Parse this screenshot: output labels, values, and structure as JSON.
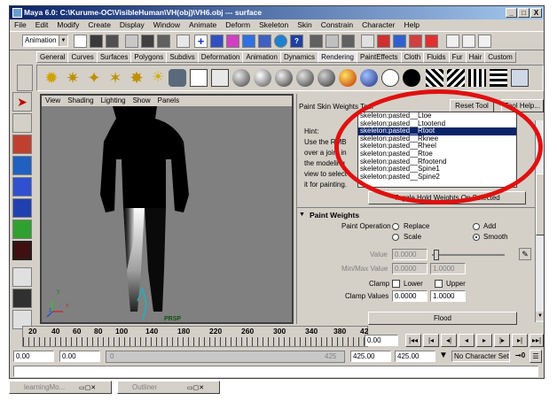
{
  "window": {
    "title": "Maya 6.0: C:\\Kurume-OC\\VisibleHuman\\VH(obj)\\VH6.obj   ---   surface",
    "minimize": "_",
    "maximize": "□",
    "close": "X"
  },
  "menu": [
    "File",
    "Edit",
    "Modify",
    "Create",
    "Display",
    "Window",
    "Animate",
    "Deform",
    "Skeleton",
    "Skin",
    "Constrain",
    "Character",
    "Help"
  ],
  "module_combo": "Animation",
  "shelf_tabs": [
    {
      "label": "General",
      "active": false
    },
    {
      "label": "Curves",
      "active": false
    },
    {
      "label": "Surfaces",
      "active": false
    },
    {
      "label": "Polygons",
      "active": false
    },
    {
      "label": "Subdivs",
      "active": false
    },
    {
      "label": "Deformation",
      "active": false
    },
    {
      "label": "Animation",
      "active": false
    },
    {
      "label": "Dynamics",
      "active": false
    },
    {
      "label": "Rendering",
      "active": true
    },
    {
      "label": "PaintEffects",
      "active": false
    },
    {
      "label": "Cloth",
      "active": false
    },
    {
      "label": "Fluids",
      "active": false
    },
    {
      "label": "Fur",
      "active": false
    },
    {
      "label": "Hair",
      "active": false
    },
    {
      "label": "Custom",
      "active": false
    }
  ],
  "viewport": {
    "menu": [
      "View",
      "Shading",
      "Lighting",
      "Show",
      "Panels"
    ],
    "camera_label": "PRSP",
    "axis_labels": {
      "y": "y",
      "x": "x",
      "z": "z"
    }
  },
  "tool_settings": {
    "title": "Paint Skin Weights Tool",
    "reset_button": "Reset Tool",
    "help_button": "Tool Help...",
    "hint_lines": [
      "Hint:",
      "Use the RMB",
      "over a joint in",
      "the modeling",
      "view to select",
      "it for painting."
    ],
    "joints": [
      "skeleton:pasted__Ltoe",
      "skeleton:pasted__Ltootend",
      "skeleton:pasted__Rtoot",
      "skeleton:pasted__Rknee",
      "skeleton:pasted__Rheel",
      "skeleton:pasted__Rtoe",
      "skeleton:pasted__Rfootend",
      "skeleton:pasted__Spine1",
      "skeleton:pasted__Spine2"
    ],
    "selected_joint_index": 2,
    "toggle_button": "Toggle Hold Weights On Selected",
    "section_title": "Paint Weights",
    "paint_operation_label": "Paint Operation",
    "operations": [
      {
        "label": "Replace",
        "selected": false
      },
      {
        "label": "Add",
        "selected": false
      },
      {
        "label": "Scale",
        "selected": false
      },
      {
        "label": "Smooth",
        "selected": true
      }
    ],
    "value_label": "Value",
    "value": "0.0000",
    "minmax_label": "Min/Max Value",
    "min_value": "0.0000",
    "max_value": "1.0000",
    "clamp_label": "Clamp",
    "clamp_lower": "Lower",
    "clamp_upper": "Upper",
    "clamp_values_label": "Clamp Values",
    "clamp_min": "0.0000",
    "clamp_max": "1.0000",
    "flood_button": "Flood"
  },
  "timeline": {
    "ticks": [
      "20",
      "40",
      "60",
      "80",
      "100",
      "140",
      "180",
      "220",
      "260",
      "300",
      "340",
      "380",
      "42"
    ],
    "current_frame": "0.00",
    "playback_buttons": [
      "|◂◂",
      "|◂",
      "◂|",
      "◂",
      "▸",
      "|▸",
      "▸|",
      "▸▸|"
    ]
  },
  "range": {
    "start": "0.00",
    "start2": "0.00",
    "slider_left": "0",
    "slider_right": "425",
    "end2": "425.00",
    "end": "425.00",
    "character_set": "No Character Set"
  },
  "taskbar": [
    {
      "label": "learningMo..."
    },
    {
      "label": "Outliner"
    }
  ],
  "colors": {
    "highlight_oval": "#e01010",
    "selection": "#0a246a",
    "chrome": "#d4d0c8"
  }
}
